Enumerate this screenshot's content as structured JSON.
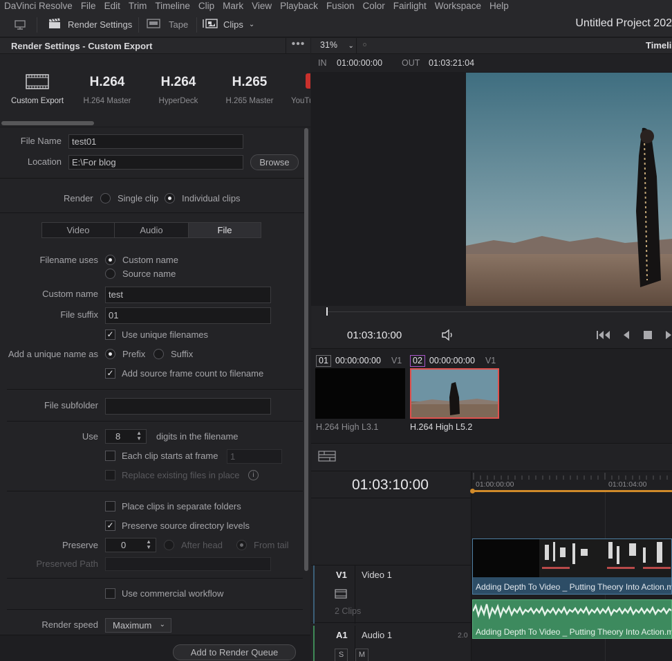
{
  "menu": {
    "items": [
      "DaVinci Resolve",
      "File",
      "Edit",
      "Trim",
      "Timeline",
      "Clip",
      "Mark",
      "View",
      "Playback",
      "Fusion",
      "Color",
      "Fairlight",
      "Workspace",
      "Help"
    ]
  },
  "toolbar": {
    "render_settings": "Render Settings",
    "tape": "Tape",
    "clips": "Clips",
    "project_title": "Untitled Project 202"
  },
  "render_panel": {
    "title": "Render Settings - Custom Export",
    "presets": [
      {
        "big": "",
        "label": "Custom Export",
        "icon": "film-strip-icon"
      },
      {
        "big": "H.264",
        "label": "H.264 Master"
      },
      {
        "big": "H.264",
        "label": "HyperDeck"
      },
      {
        "big": "H.265",
        "label": "H.265 Master"
      },
      {
        "big": "",
        "label": "YouTu",
        "icon": "youtube-icon"
      }
    ],
    "file_name_label": "File Name",
    "file_name_value": "test01",
    "location_label": "Location",
    "location_value": "E:\\For blog",
    "browse": "Browse",
    "render_label": "Render",
    "single_clip": "Single clip",
    "individual_clips": "Individual clips",
    "tabs": [
      "Video",
      "Audio",
      "File"
    ],
    "filename_uses_label": "Filename uses",
    "custom_name_opt": "Custom name",
    "source_name_opt": "Source name",
    "custom_name_label": "Custom name",
    "custom_name_value": "test",
    "file_suffix_label": "File suffix",
    "file_suffix_value": "01",
    "use_unique": "Use unique filenames",
    "add_unique_label": "Add a unique name as",
    "prefix": "Prefix",
    "suffix": "Suffix",
    "add_frame_count": "Add source frame count to filename",
    "file_subfolder_label": "File subfolder",
    "use_label": "Use",
    "digits_value": "8",
    "digits_suffix": "digits in the filename",
    "each_clip_starts": "Each clip starts at frame",
    "each_clip_value": "1",
    "replace_existing": "Replace existing files in place",
    "place_separate": "Place clips in separate folders",
    "preserve_source": "Preserve source directory levels",
    "preserve_label": "Preserve",
    "preserve_value": "0",
    "after_head": "After head",
    "from_tail": "From tail",
    "preserved_path_label": "Preserved Path",
    "commercial": "Use commercial workflow",
    "render_speed_label": "Render speed",
    "render_speed_value": "Maximum",
    "add_queue": "Add to Render Queue"
  },
  "viewer": {
    "zoom": "31%",
    "timeline_label": "Timeli",
    "in_label": "IN",
    "in_tc": "01:00:00:00",
    "out_label": "OUT",
    "out_tc": "01:03:21:04",
    "current_tc": "01:03:10:00"
  },
  "clips": [
    {
      "num": "01",
      "tc": "00:00:00:00",
      "track": "V1",
      "codec": "H.264 High L3.1"
    },
    {
      "num": "02",
      "tc": "00:00:00:00",
      "track": "V1",
      "codec": "H.264 High L5.2"
    }
  ],
  "timeline": {
    "current_tc": "01:03:10:00",
    "ruler": [
      "01:00:00:00",
      "01:01:04:00"
    ],
    "video_track": {
      "id": "V1",
      "name": "Video 1",
      "count": "2 Clips",
      "clip_title": "Adding Depth To Video _ Putting Theory Into Action.mp"
    },
    "audio_track": {
      "id": "A1",
      "name": "Audio 1",
      "channels": "2.0",
      "s": "S",
      "m": "M",
      "clip_title": "Adding Depth To Video _ Putting Theory Into Action.mp"
    }
  }
}
